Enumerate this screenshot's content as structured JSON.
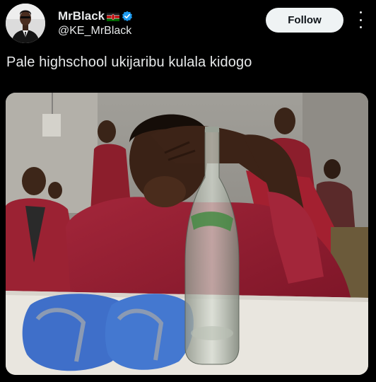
{
  "author": {
    "display_name": "MrBlack",
    "handle": "@KE_MrBlack",
    "flag_icon": "kenya-flag-icon",
    "verified_icon": "verified-badge-icon",
    "verified_color": "#1d9bf0"
  },
  "actions": {
    "follow_label": "Follow",
    "more_icon": "more-options-icon"
  },
  "post": {
    "text": "Pale highschool ukijaribu kulala kidogo"
  },
  "theme": {
    "background": "#000000",
    "text": "#e7e9ea",
    "follow_bg": "#eff3f4"
  }
}
